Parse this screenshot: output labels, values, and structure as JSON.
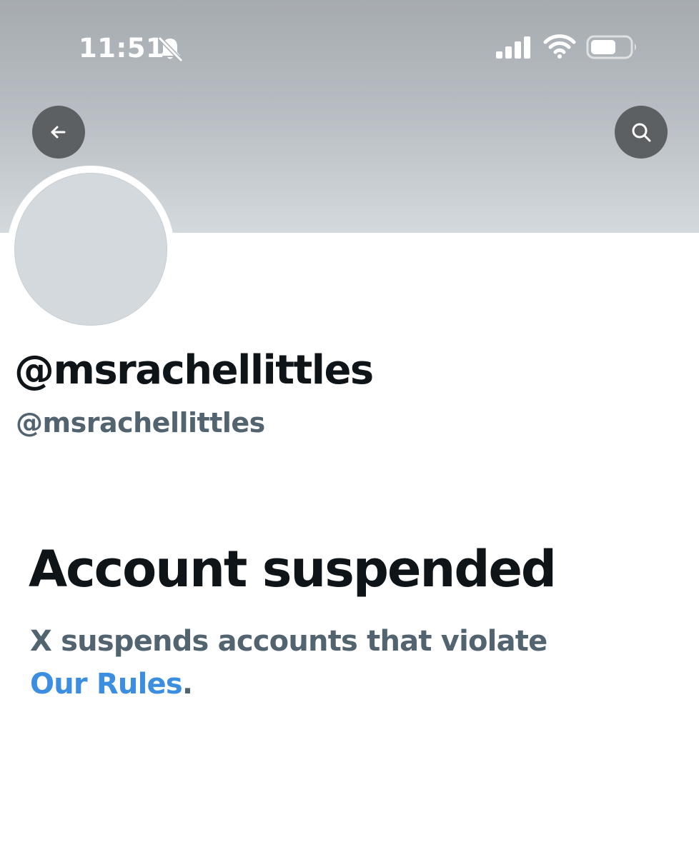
{
  "status_bar": {
    "time": "11:51",
    "icons": [
      "bell-slash-icon",
      "cellular-signal-icon",
      "wifi-icon",
      "battery-icon"
    ]
  },
  "header": {
    "back_icon": "arrow-left-icon",
    "search_icon": "search-icon",
    "banner_color_top": "#a6abb0",
    "banner_color_bottom": "#d3d9dc"
  },
  "profile": {
    "display_name": "@msrachellittles",
    "handle": "@msrachellittles",
    "avatar_color": "#d3d9dd"
  },
  "suspension": {
    "title": "Account suspended",
    "message": "X suspends accounts that violate",
    "link_label": "Our Rules",
    "trailing": ".",
    "link_color": "#3b8ee0"
  }
}
